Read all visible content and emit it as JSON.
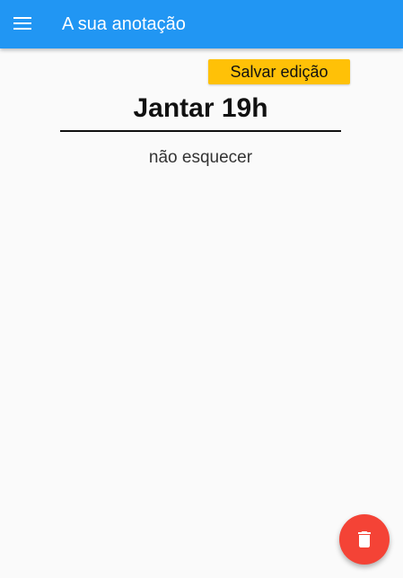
{
  "appbar": {
    "title": "A sua anotação",
    "menu_icon": "menu-icon",
    "color": "#2196f3"
  },
  "note": {
    "save_label": "Salvar edição",
    "save_color": "#ffc107",
    "title": "Jantar 19h",
    "content": "não esquecer"
  },
  "fab": {
    "icon": "delete-icon",
    "color": "#f44336"
  }
}
